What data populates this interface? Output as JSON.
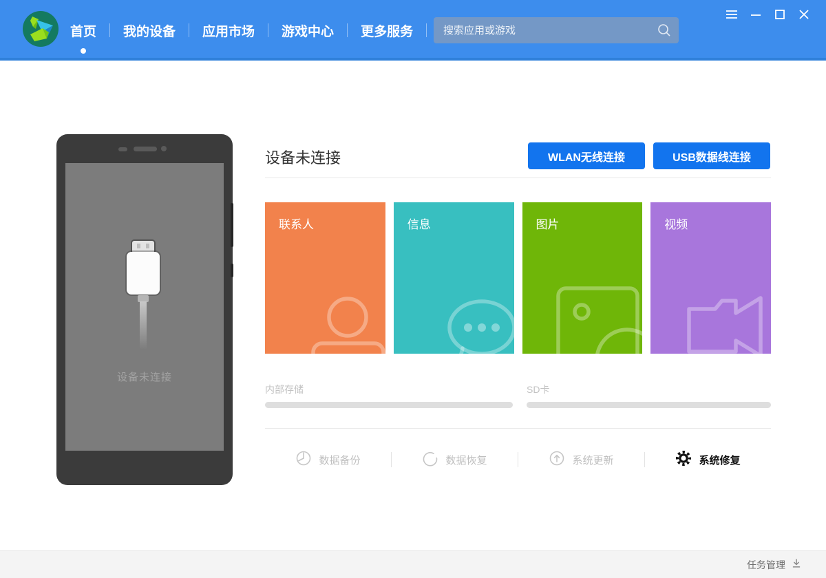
{
  "colors": {
    "header_blue": "#3d8ded",
    "header_edge": "#2f80da",
    "button_blue": "#1274ee",
    "tile_orange": "#f2824c",
    "tile_teal": "#38bfc0",
    "tile_green": "#6fb608",
    "tile_purple": "#a876dc"
  },
  "header": {
    "nav": [
      {
        "label": "首页",
        "active": true
      },
      {
        "label": "我的设备",
        "active": false
      },
      {
        "label": "应用市场",
        "active": false
      },
      {
        "label": "游戏中心",
        "active": false
      },
      {
        "label": "更多服务",
        "active": false
      }
    ],
    "search": {
      "placeholder": "搜索应用或游戏",
      "icon": "search-icon"
    },
    "window_icons": [
      "menu-icon",
      "minimize-icon",
      "maximize-icon",
      "close-icon"
    ]
  },
  "phone": {
    "status_text": "设备未连接"
  },
  "main": {
    "title": "设备未连接",
    "connect_buttons": [
      {
        "label": "WLAN无线连接"
      },
      {
        "label": "USB数据线连接"
      }
    ],
    "tiles": [
      {
        "label": "联系人",
        "color": "#f2824c",
        "icon": "contact-person-icon"
      },
      {
        "label": "信息",
        "color": "#38bfc0",
        "icon": "message-bubble-icon"
      },
      {
        "label": "图片",
        "color": "#6fb608",
        "icon": "photo-frame-icon"
      },
      {
        "label": "视频",
        "color": "#a876dc",
        "icon": "video-camera-icon"
      }
    ],
    "storage": [
      {
        "label": "内部存储",
        "percent": 0
      },
      {
        "label": "SD卡",
        "percent": 0
      }
    ],
    "actions": [
      {
        "label": "数据备份",
        "enabled": false,
        "icon": "backup-pie-icon"
      },
      {
        "label": "数据恢复",
        "enabled": false,
        "icon": "restore-arc-icon"
      },
      {
        "label": "系统更新",
        "enabled": false,
        "icon": "update-arrow-icon"
      },
      {
        "label": "系统修复",
        "enabled": true,
        "icon": "gear-icon"
      }
    ]
  },
  "statusbar": {
    "task_label": "任务管理",
    "icon": "download-icon"
  }
}
